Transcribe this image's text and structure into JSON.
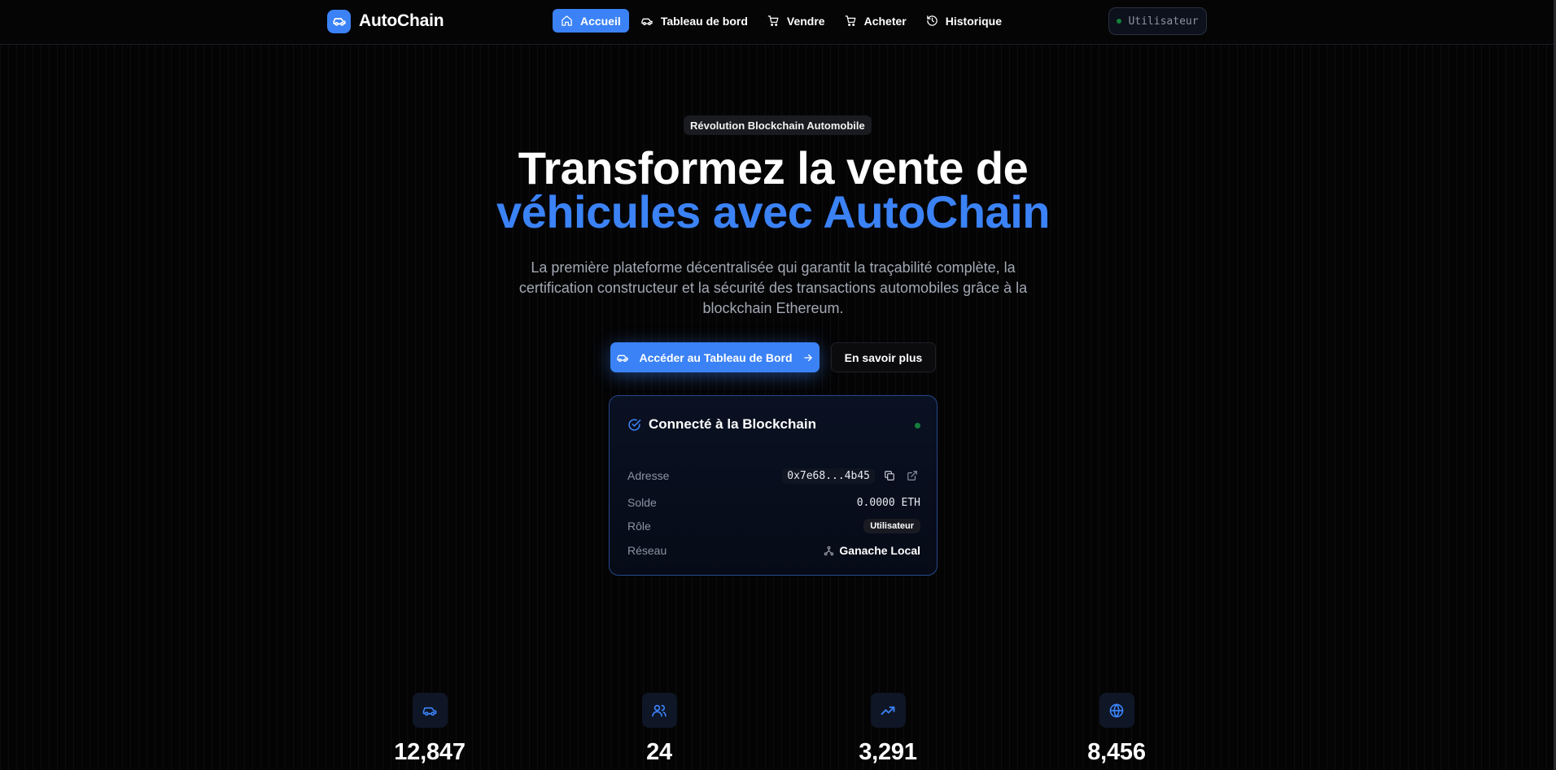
{
  "brand": {
    "name": "AutoChain",
    "icon": "car-icon"
  },
  "nav": {
    "items": [
      {
        "label": "Accueil",
        "icon": "home-icon",
        "active": true
      },
      {
        "label": "Tableau de bord",
        "icon": "car-icon",
        "active": false
      },
      {
        "label": "Vendre",
        "icon": "cart-icon",
        "active": false
      },
      {
        "label": "Acheter",
        "icon": "cart-icon",
        "active": false
      },
      {
        "label": "Historique",
        "icon": "history-icon",
        "active": false
      }
    ],
    "user_label": "Utilisateur"
  },
  "hero": {
    "badge": "Révolution Blockchain Automobile",
    "title_line1": "Transformez la vente de",
    "title_line2": "véhicules avec AutoChain",
    "description": "La première plateforme décentralisée qui garantit la traçabilité complète, la certification constructeur et la sécurité des transactions automobiles grâce à la blockchain Ethereum.",
    "cta_primary": "Accéder au Tableau de Bord",
    "cta_secondary": "En savoir plus"
  },
  "wallet": {
    "title": "Connecté à la Blockchain",
    "address_label": "Adresse",
    "address": "0x7e68...4b45",
    "balance_label": "Solde",
    "balance": "0.0000 ETH",
    "role_label": "Rôle",
    "role": "Utilisateur",
    "network_label": "Réseau",
    "network": "Ganache Local"
  },
  "stats": [
    {
      "icon": "car-icon",
      "value": "12,847"
    },
    {
      "icon": "users-icon",
      "value": "24"
    },
    {
      "icon": "trending-up-icon",
      "value": "3,291"
    },
    {
      "icon": "globe-icon",
      "value": "8,456"
    }
  ],
  "colors": {
    "accent": "#3b82f6",
    "background": "#040405",
    "status_green": "#15803d",
    "muted_text": "#a3a8b3"
  }
}
